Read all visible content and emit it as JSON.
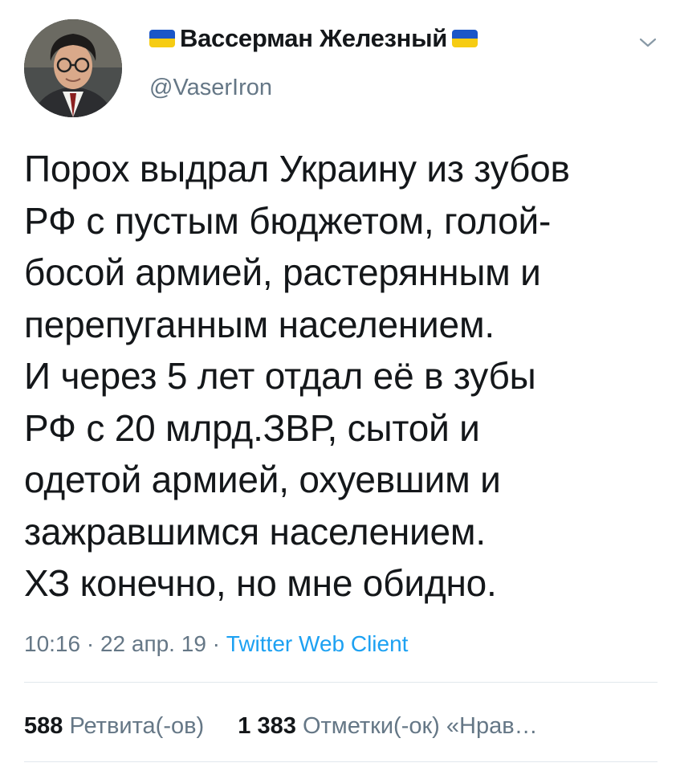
{
  "user": {
    "display_name": "Вассерман Железный",
    "handle": "@VaserIron"
  },
  "tweet": {
    "text": "Порох выдрал Украину из зубов\nРФ с пустым бюджетом, голой-\nбосой армией, растерянным и\nперепуганным населением.\nИ через 5 лет отдал её в зубы\nРФ с 20 млрд.ЗВР, сытой и\nодетой армией, охуевшим и\nзажравшимся населением.\nХЗ конечно, но мне обидно.",
    "time": "10:16 · 22 апр. 19 · ",
    "client": "Twitter Web Client"
  },
  "stats": {
    "retweets_count": "588",
    "retweets_label": "Ретвита(-ов)",
    "likes_count": "1 383",
    "likes_label": "Отметки(-ок) «Нрав…"
  },
  "colors": {
    "flag_blue": "#1a56c8",
    "flag_yellow": "#f6cc13",
    "secondary_text": "#657786",
    "link": "#1da1f2"
  },
  "icons": {
    "flag": "ukraine-flag-icon",
    "menu": "chevron-down-icon"
  }
}
